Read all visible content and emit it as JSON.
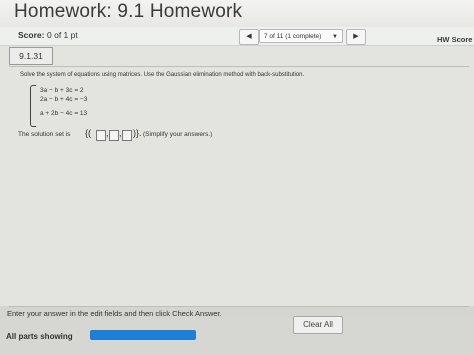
{
  "header": {
    "title": "Homework: 9.1 Homework"
  },
  "score": {
    "label": "Score:",
    "value": "0 of 1 pt"
  },
  "navigation": {
    "prev_icon": "triangle-left",
    "next_icon": "triangle-right",
    "question_selector": "7 of 11 (1 complete)",
    "selector_caret": "▼",
    "prev_glyph": "◀",
    "next_glyph": "▶"
  },
  "hw_score_label": "HW Score",
  "question": {
    "id": "9.1.31",
    "instructions": "Solve the system of equations using matrices. Use the Gaussian elimination method with back-substitution.",
    "equations": [
      "3a −  b + 3c =  2",
      "2a −  b + 4c = −3",
      "a + 2b − 4c = 13"
    ],
    "solution_prefix": "The solution set is",
    "open_brace": "{(",
    "close_brace": ")}.",
    "simplify_note": "(Simplify your answers.)"
  },
  "footer": {
    "instruction": "Enter your answer in the edit fields and then click Check Answer.",
    "parts_label": "All parts showing",
    "clear_label": "Clear All",
    "progress_fraction": 1.0
  },
  "colors": {
    "progress": "#1f7fd6"
  }
}
